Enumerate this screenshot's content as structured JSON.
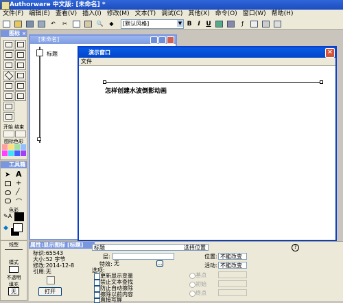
{
  "app": {
    "title": "Authorware 中文版: [未命名] *"
  },
  "menubar": {
    "items": [
      "文件(F)",
      "编辑(E)",
      "查看(V)",
      "插入(I)",
      "修改(M)",
      "文本(T)",
      "调试(C)",
      "其他(X)",
      "命令(O)",
      "窗口(W)",
      "帮助(H)"
    ]
  },
  "toolbar": {
    "style_select": "[默认风格]",
    "bold": "B",
    "italic": "I",
    "underline": "U"
  },
  "icon_panel": {
    "title": "图标",
    "start_label": "开始",
    "end_label": "结束",
    "color_label": "图标色彩"
  },
  "tool_panel": {
    "title": "工具箱",
    "text_tool": "A",
    "colors_label": "色彩",
    "lines_label": "线型",
    "modes_label": "模式",
    "fill_label": "填充",
    "mode_value": "不透明",
    "fill_value": "无"
  },
  "untitled_window": {
    "title": "[未命名]",
    "flow_icon_label": "标题"
  },
  "presentation": {
    "title": "演示窗口",
    "menu_file": "文件",
    "text_content": "怎样创建水波倒影动画"
  },
  "properties": {
    "title": "属性:显示图标 [标题]",
    "identifier": "标识:65543",
    "size": "大小:52 字节",
    "modified": "修改:2014-12-8",
    "reference": "引用:无",
    "name_value": "标题",
    "open_button": "打开",
    "layer_label": "层:",
    "effect_label": "特效:",
    "effect_value": "无",
    "options_label": "选项:",
    "options": [
      "更新显示变量",
      "禁止文本查找",
      "防止自动擦除",
      "擦除以前内容",
      "直接写屏"
    ],
    "position_label": "选择位置",
    "position_field_label": "位置:",
    "position_value": "不能改变",
    "active_label": "活动:",
    "active_value": "不能改变",
    "base_label": "基点",
    "initial_label": "初始",
    "end_label": "终点",
    "help_icon": "?"
  }
}
